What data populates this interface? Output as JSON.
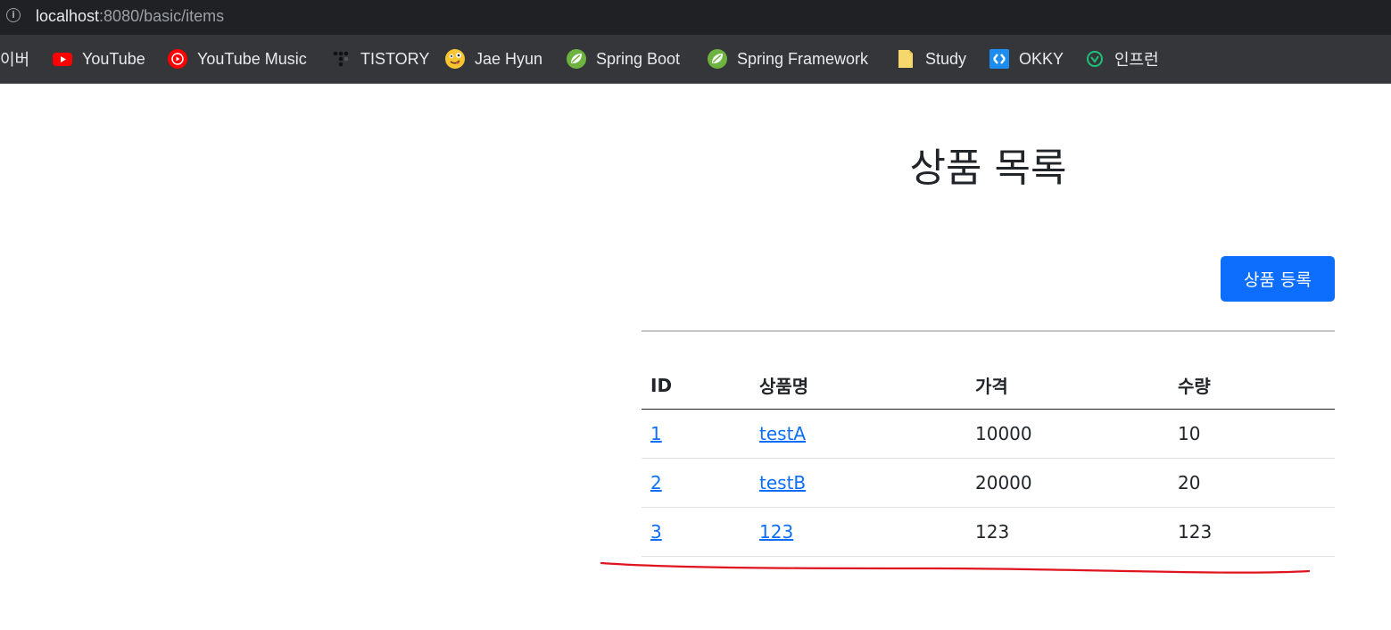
{
  "browser": {
    "url_host": "localhost",
    "url_rest": ":8080/basic/items",
    "bookmarks": [
      {
        "label": "이버",
        "icon": "naver-icon"
      },
      {
        "label": "YouTube",
        "icon": "youtube-icon"
      },
      {
        "label": "YouTube Music",
        "icon": "youtube-music-icon"
      },
      {
        "label": "TISTORY",
        "icon": "tistory-icon"
      },
      {
        "label": "Jae Hyun",
        "icon": "emoji-face-icon"
      },
      {
        "label": "Spring Boot",
        "icon": "spring-leaf-icon"
      },
      {
        "label": "Spring Framework",
        "icon": "spring-leaf-icon"
      },
      {
        "label": "Study",
        "icon": "folder-icon"
      },
      {
        "label": "OKKY",
        "icon": "okky-icon"
      },
      {
        "label": "인프런",
        "icon": "inflearn-icon"
      }
    ]
  },
  "page": {
    "title": "상품 목록",
    "add_button": "상품 등록"
  },
  "table": {
    "headers": [
      "ID",
      "상품명",
      "가격",
      "수량"
    ],
    "rows": [
      {
        "id": "1",
        "name": "testA",
        "price": "10000",
        "quantity": "10"
      },
      {
        "id": "2",
        "name": "testB",
        "price": "20000",
        "quantity": "20"
      },
      {
        "id": "3",
        "name": "123",
        "price": "123",
        "quantity": "123"
      }
    ]
  },
  "colors": {
    "primary": "#0d6efd",
    "annotation": "#e0141e",
    "address_bar": "#202124",
    "bookmarks_bar": "#35363a"
  }
}
